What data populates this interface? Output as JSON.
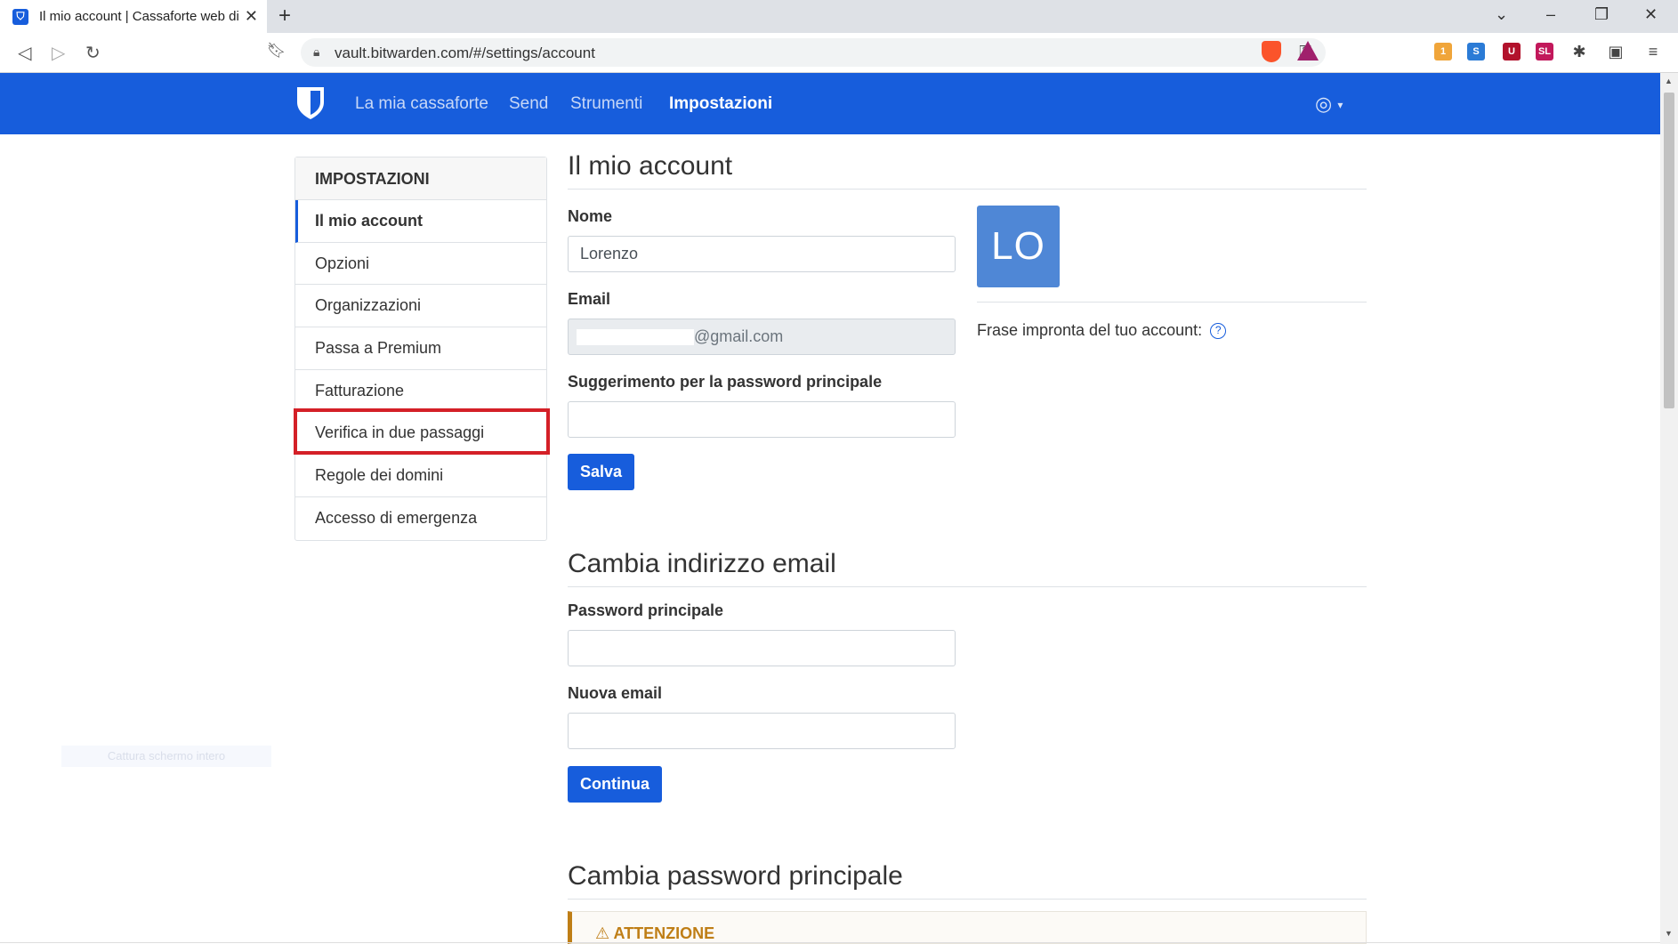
{
  "browser": {
    "tab_title": "Il mio account | Cassaforte web di",
    "tab_close": "✕",
    "new_tab": "+",
    "url": "vault.bitwarden.com/#/settings/account",
    "favicon": "bitwarden-shield-icon"
  },
  "header": {
    "nav": [
      "La mia cassaforte",
      "Send",
      "Strumenti",
      "Impostazioni"
    ],
    "active_nav": "Impostazioni",
    "brand_color": "#175ddc"
  },
  "sidebar": {
    "heading": "IMPOSTAZIONI",
    "items": [
      {
        "label": "Il mio account"
      },
      {
        "label": "Opzioni"
      },
      {
        "label": "Organizzazioni"
      },
      {
        "label": "Passa a Premium"
      },
      {
        "label": "Fatturazione"
      },
      {
        "label": "Verifica in due passaggi"
      },
      {
        "label": "Regole dei domini"
      },
      {
        "label": "Accesso di emergenza"
      }
    ],
    "active_item": "Il mio account",
    "highlighted_item": "Verifica in due passaggi",
    "highlight_color": "#d42027"
  },
  "account": {
    "title": "Il mio account",
    "name_label": "Nome",
    "name_value": "Lorenzo",
    "email_label": "Email",
    "email_value": "@gmail.com",
    "hint_label": "Suggerimento per la password principale",
    "hint_value": "",
    "save_label": "Salva",
    "avatar_initials": "LO",
    "avatar_color": "#4f87d6",
    "fingerprint_label": "Frase impronta del tuo account:"
  },
  "change_email": {
    "title": "Cambia indirizzo email",
    "password_label": "Password principale",
    "new_email_label": "Nuova email",
    "continue_label": "Continua"
  },
  "change_password": {
    "title": "Cambia password principale",
    "warning_title": "ATTENZIONE",
    "warning_color": "#bf7e16"
  },
  "ghost": {
    "text": "Cattura schermo intero"
  }
}
